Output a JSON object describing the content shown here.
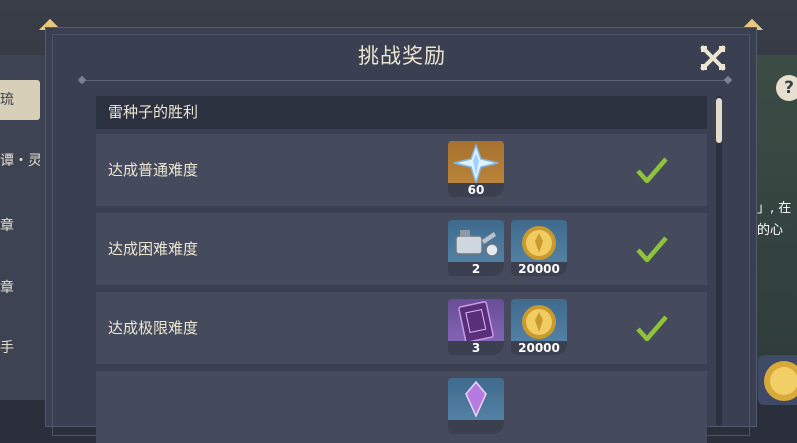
{
  "dialog": {
    "title": "挑战奖励",
    "section_title": "雷种子的胜利"
  },
  "rows": [
    {
      "label": "达成普通难度",
      "rewards": [
        {
          "item": "primogem-icon",
          "quantity": "60",
          "quality": "orange"
        }
      ],
      "completed": true
    },
    {
      "label": "达成困难难度",
      "rewards": [
        {
          "item": "watering-can-icon",
          "quantity": "2",
          "quality": "blue"
        },
        {
          "item": "mora-coin-icon",
          "quantity": "20000",
          "quality": "blue"
        }
      ],
      "completed": true
    },
    {
      "label": "达成极限难度",
      "rewards": [
        {
          "item": "purple-book-icon",
          "quantity": "3",
          "quality": "purple"
        },
        {
          "item": "mora-coin-icon",
          "quantity": "20000",
          "quality": "blue"
        }
      ],
      "completed": true
    },
    {
      "label": "",
      "rewards": [
        {
          "item": "purple-crystal-icon",
          "quantity": "",
          "quality": "blue"
        }
      ],
      "completed": false
    }
  ],
  "background": {
    "left_menu": [
      "琉",
      "谭・灵",
      "章",
      "章",
      "手"
    ],
    "right_text": [
      "」, 在",
      "的心"
    ],
    "help_label": "?"
  },
  "colors": {
    "panel": "#3a4052",
    "row": "#454b5c",
    "header": "#2c3140",
    "check": "#8fc33a",
    "accent_gold": "#e8c77c"
  }
}
